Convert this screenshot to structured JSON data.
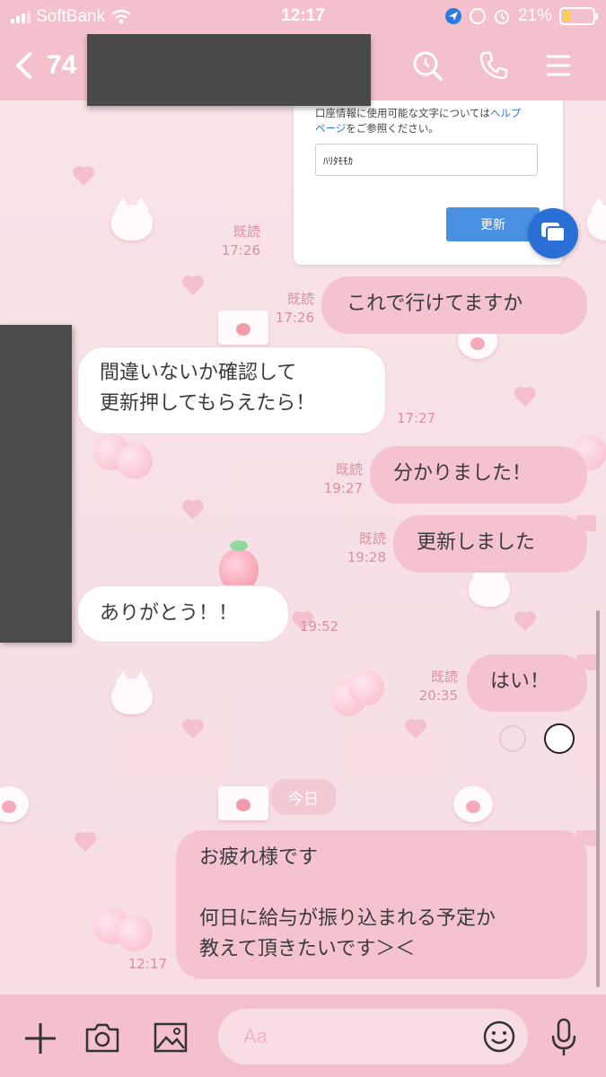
{
  "status_bar": {
    "carrier": "SoftBank",
    "time": "12:17",
    "battery": "21%"
  },
  "header": {
    "back_count": "74"
  },
  "embedded_card": {
    "text_prefix": "口座情報に使用可能な文字については",
    "link_part1": "ヘルプ",
    "link_part2": "ページ",
    "text_suffix": "をご参照ください。",
    "input_value": "ﾊﾘﾀﾓﾓｶ",
    "button_label": "更新",
    "read": "既読",
    "time": "17:26"
  },
  "messages": [
    {
      "side": "me",
      "text": "これで行けてますか",
      "read": "既読",
      "time": "17:26"
    },
    {
      "side": "them",
      "text": "間違いないか確認して\n更新押してもらえたら！",
      "time": "17:27"
    },
    {
      "side": "me",
      "text": "分かりました！",
      "read": "既読",
      "time": "19:27"
    },
    {
      "side": "me",
      "text": "更新しました",
      "read": "既読",
      "time": "19:28"
    },
    {
      "side": "them",
      "text": "ありがとう！！",
      "time": "19:52"
    },
    {
      "side": "me",
      "text": "はい！",
      "read": "既読",
      "time": "20:35"
    },
    {
      "side": "me",
      "text": "お疲れ様です\n\n何日に給与が振り込まれる予定か\n教えて頂きたいです＞＜",
      "time": "12:17"
    }
  ],
  "date_separator": "今日",
  "input_bar": {
    "placeholder": "Aa"
  },
  "colors": {
    "header_pink": "#f4c0cc",
    "my_bubble": "#f4c3cf",
    "meta_text": "#d98fa0",
    "card_button": "#4a90e2"
  },
  "icons": [
    "back-chevron-icon",
    "search-icon",
    "phone-icon",
    "menu-icon",
    "chat-bubble-icon",
    "plus-icon",
    "camera-icon",
    "image-icon",
    "emoji-icon",
    "mic-icon"
  ]
}
